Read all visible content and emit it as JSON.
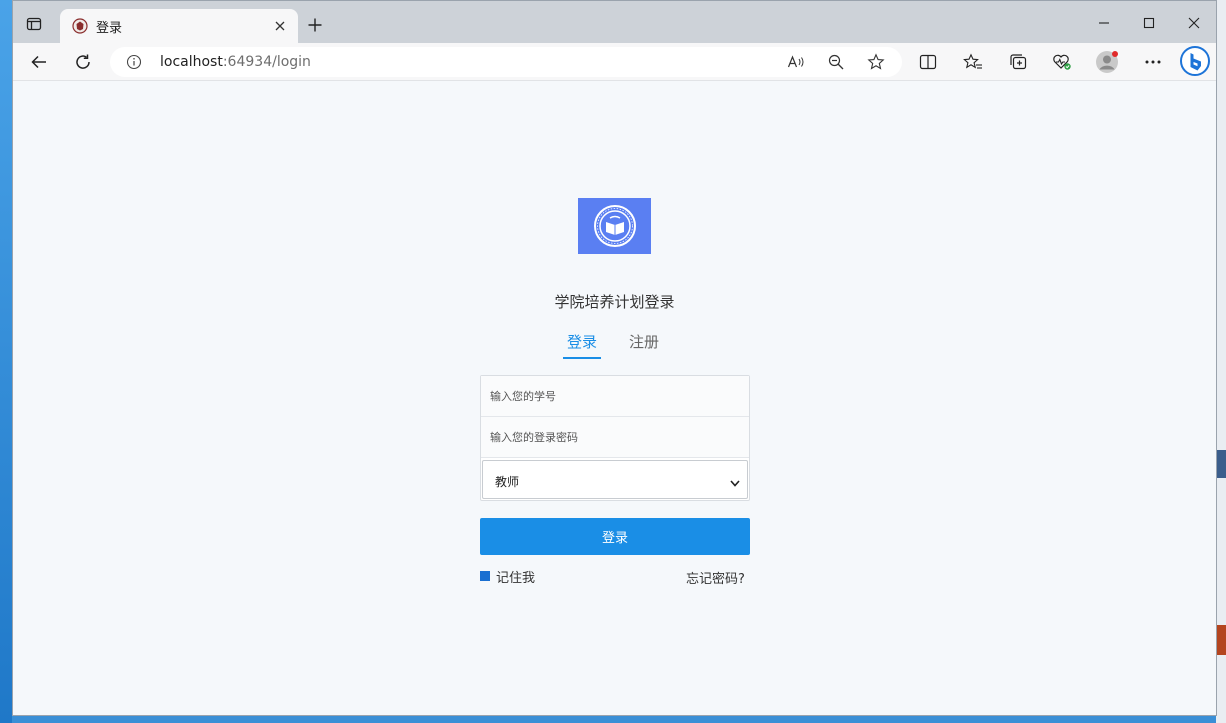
{
  "browser": {
    "tab": {
      "title": "登录"
    },
    "address": {
      "host": "localhost",
      "rest": ":64934/login"
    }
  },
  "login": {
    "title": "学院培养计划登录",
    "tab_login": "登录",
    "tab_register": "注册",
    "id_placeholder": "输入您的学号",
    "password_placeholder": "输入您的登录密码",
    "role_selected": "教师",
    "submit_label": "登录",
    "remember_label": "记住我",
    "forgot_label": "忘记密码?"
  },
  "colors": {
    "accent": "#1a8ee6",
    "logo_bg": "#5a7ff2"
  }
}
